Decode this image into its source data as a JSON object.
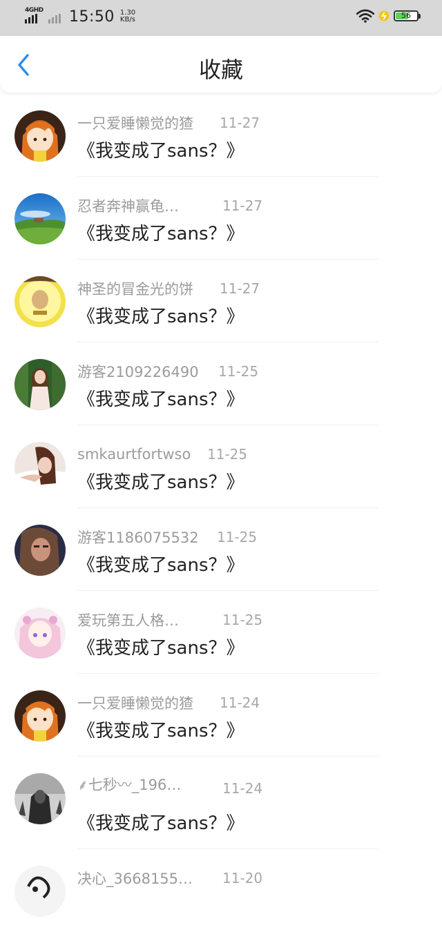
{
  "status_bar": {
    "network_label": "4GHD",
    "time": "15:50",
    "speed_value": "1.30",
    "speed_unit": "KB/s",
    "battery_level": "56",
    "icons": [
      "signal-icon",
      "wifi-icon",
      "charging-icon",
      "battery-icon"
    ]
  },
  "header": {
    "title": "收藏",
    "back_icon": "chevron-left-icon",
    "accent_color": "#2b8ef2"
  },
  "favorites": [
    {
      "username": "一只爱睡懒觉的猹",
      "date": "11-27",
      "work": "《我变成了sans？》",
      "avatar": "anime-orange-hair"
    },
    {
      "username": "忍者奔神赢龟…",
      "date": "11-27",
      "work": "《我变成了sans？》",
      "avatar": "landscape-sky"
    },
    {
      "username": "神圣的冒金光的饼",
      "date": "11-27",
      "work": "《我变成了sans？》",
      "avatar": "golden-meme"
    },
    {
      "username": "游客2109226490",
      "date": "11-25",
      "work": "《我变成了sans？》",
      "avatar": "photo-girl-forest"
    },
    {
      "username": "smkaurtfortwso",
      "date": "11-25",
      "work": "《我变成了sans？》",
      "avatar": "photo-girl-bed"
    },
    {
      "username": "游客1186075532",
      "date": "11-25",
      "work": "《我变成了sans？》",
      "avatar": "photo-dark-portrait"
    },
    {
      "username": "爱玩第五人格…",
      "date": "11-25",
      "work": "《我变成了sans？》",
      "avatar": "anime-pink-hair"
    },
    {
      "username": "一只爱睡懒觉的猹",
      "date": "11-24",
      "work": "《我变成了sans？》",
      "avatar": "anime-orange-hair"
    },
    {
      "username": "⸙七秒〰_196…",
      "date": "11-24",
      "work": "《我变成了sans？》",
      "avatar": "grayscale-figure"
    },
    {
      "username": "决心_3668155…",
      "date": "11-20",
      "work": "",
      "avatar": "sketch-white"
    }
  ]
}
